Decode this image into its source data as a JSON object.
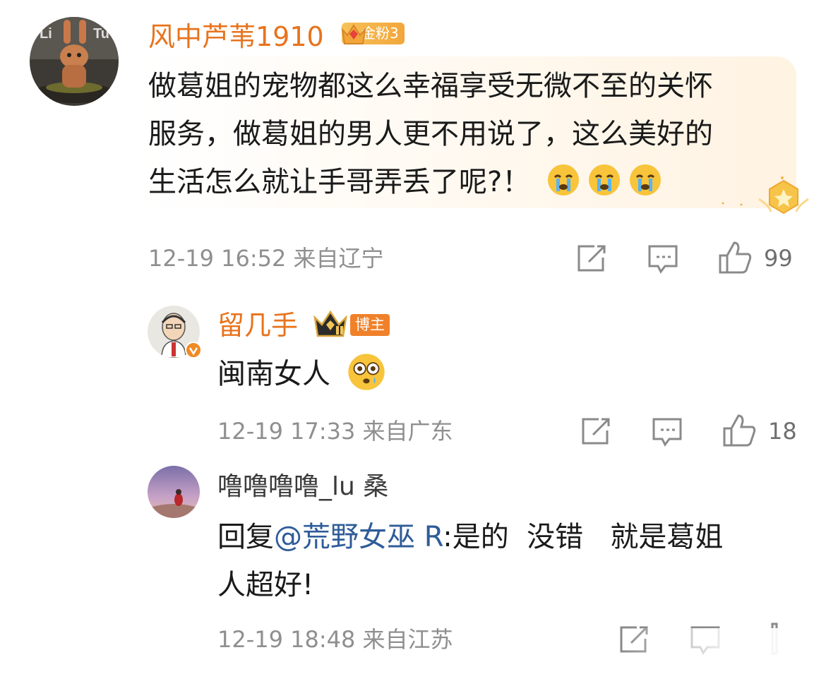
{
  "comments": [
    {
      "username": "风中芦苇1910",
      "badge": "金粉3",
      "text_line1": "做葛姐的宠物都这么幸福享受无微不至的关怀",
      "text_line2": "服务，做葛姐的男人更不用说了，这么美好的",
      "text_line3": "生活怎么就让手哥弄丢了呢?！",
      "emojis": [
        "crying-face",
        "crying-face",
        "crying-face"
      ],
      "meta": "12-19 16:52 来自辽宁",
      "likes": "99"
    },
    {
      "username": "留几手",
      "badge": "博主",
      "text": "闽南女人",
      "emoji": "flushed-face",
      "meta": "12-19 17:33 来自广东",
      "likes": "18"
    },
    {
      "username": "噜噜噜噜_lu 桑",
      "reply_prefix": "回复",
      "mention": "@荒野女巫 R",
      "reply_text": ":是的  没错   就是葛姐",
      "reply_text2": "人超好!",
      "meta": "12-19 18:48 来自江苏"
    }
  ],
  "colors": {
    "username": "#e8731c",
    "mention": "#2f5c99",
    "meta": "#8f8f8f"
  },
  "icons": [
    "share-icon",
    "comment-icon",
    "like-icon"
  ]
}
